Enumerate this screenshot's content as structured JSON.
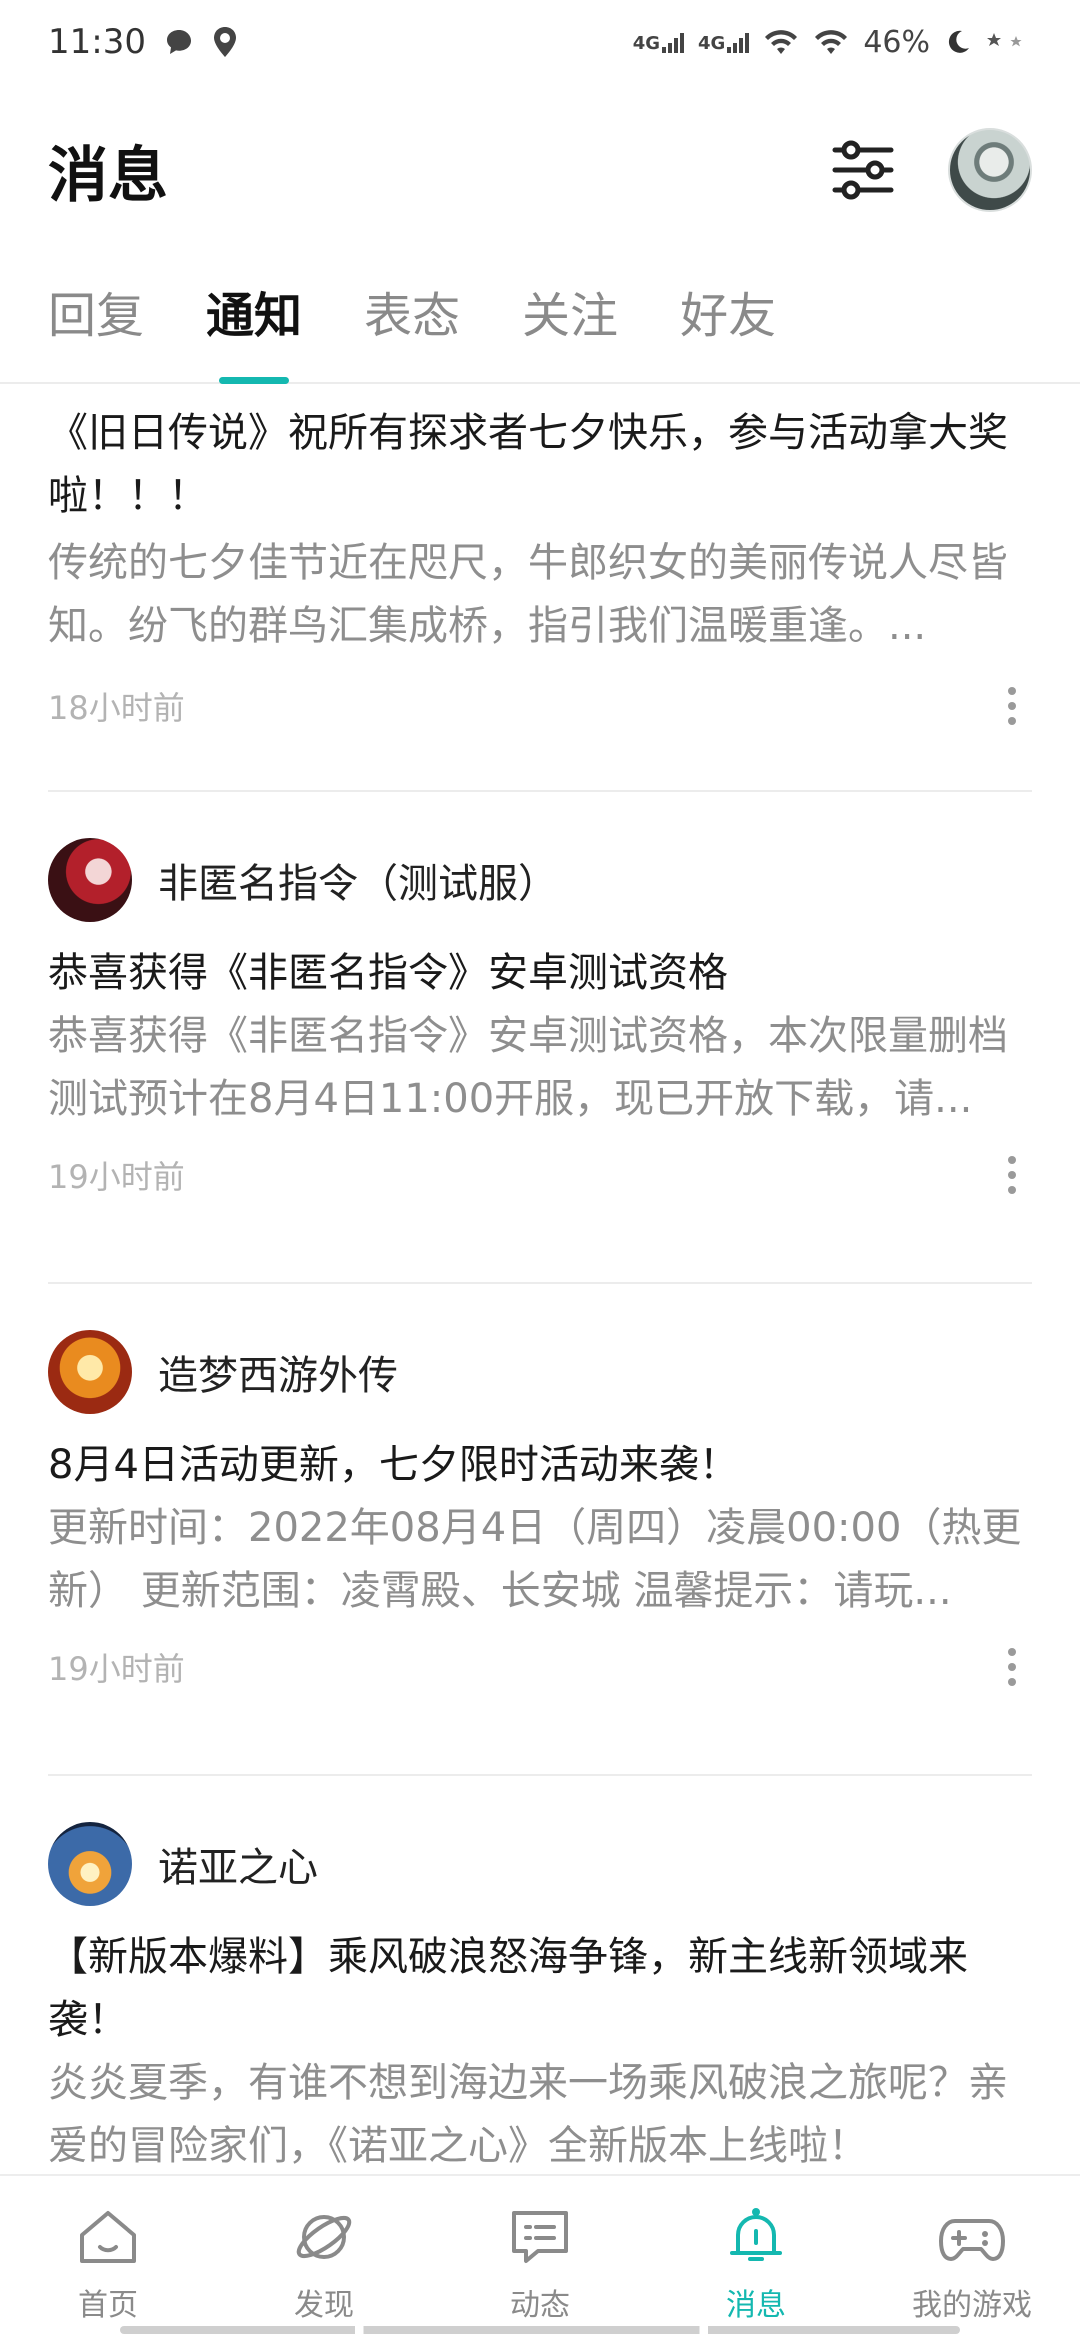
{
  "status_bar": {
    "time": "11:30",
    "network_1": "4G",
    "network_2": "4G",
    "battery": "46%"
  },
  "header": {
    "title": "消息"
  },
  "tabs": [
    {
      "label": "回复",
      "active": false
    },
    {
      "label": "通知",
      "active": true
    },
    {
      "label": "表态",
      "active": false
    },
    {
      "label": "关注",
      "active": false
    },
    {
      "label": "好友",
      "active": false
    }
  ],
  "notifications": [
    {
      "sender": "",
      "title": "《旧日传说》祝所有探求者七夕快乐，参与活动拿大奖啦！！！",
      "body": "传统的七夕佳节近在咫尺，牛郎织女的美丽传说人尽皆知。纷飞的群鸟汇集成桥，指引我们温暖重逢。...",
      "time": "18小时前"
    },
    {
      "sender": "非匿名指令（测试服）",
      "title": "恭喜获得《非匿名指令》安卓测试资格",
      "body": "恭喜获得《非匿名指令》安卓测试资格，本次限量删档测试预计在8月4日11:00开服，现已开放下载，请...",
      "time": "19小时前"
    },
    {
      "sender": "造梦西游外传",
      "title": "8月4日活动更新，七夕限时活动来袭！",
      "body": "更新时间：2022年08月4日（周四）凌晨00:00（热更新） 更新范围：凌霄殿、长安城 温馨提示：请玩...",
      "time": "19小时前"
    },
    {
      "sender": "诺亚之心",
      "title": "【新版本爆料】乘风破浪怒海争锋，新主线新领域来袭！",
      "body": "炎炎夏季，有谁不想到海边来一场乘风破浪之旅呢？亲爱的冒险家们，《诺亚之心》全新版本上线啦！",
      "time": ""
    }
  ],
  "bottom_nav": [
    {
      "label": "首页",
      "icon": "home-icon",
      "active": false
    },
    {
      "label": "发现",
      "icon": "planet-icon",
      "active": false
    },
    {
      "label": "动态",
      "icon": "chat-icon",
      "active": false
    },
    {
      "label": "消息",
      "icon": "bell-icon",
      "active": true
    },
    {
      "label": "我的游戏",
      "icon": "gamepad-icon",
      "active": false
    }
  ],
  "colors": {
    "accent": "#14b8b0",
    "muted_text": "#8e8e8e",
    "divider": "#ececec"
  }
}
